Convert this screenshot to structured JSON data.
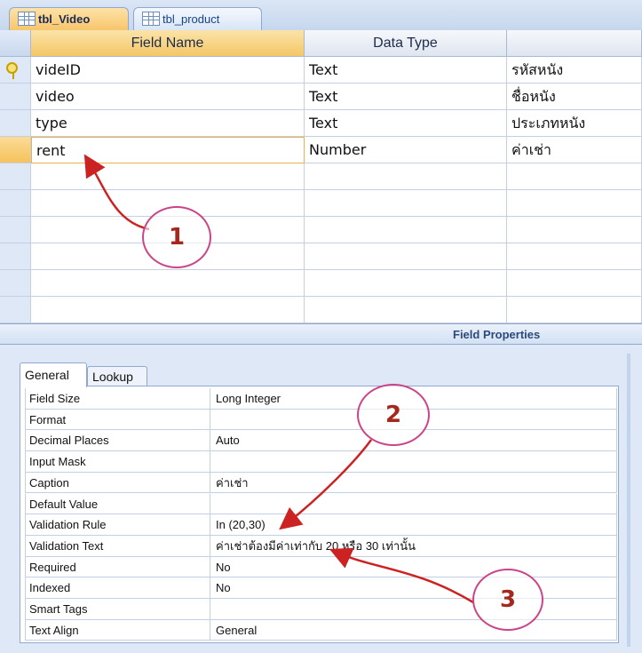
{
  "tabs": [
    {
      "label": "tbl_Video"
    },
    {
      "label": "tbl_product"
    }
  ],
  "grid": {
    "headers": {
      "field_name": "Field Name",
      "data_type": "Data Type",
      "description": ""
    },
    "rows": [
      {
        "field": "videID",
        "type": "Text",
        "description": "รหัสหนัง",
        "primary_key": true
      },
      {
        "field": "video",
        "type": "Text",
        "description": "ชื่อหนัง"
      },
      {
        "field": "type",
        "type": "Text",
        "description": "ประเภทหนัง"
      },
      {
        "field": "rent",
        "type": "Number",
        "description": "ค่าเช่า",
        "selected": true
      }
    ]
  },
  "field_properties_label": "Field Properties",
  "props_tabs": {
    "general": "General",
    "lookup": "Lookup"
  },
  "properties": [
    {
      "name": "Field Size",
      "value": "Long Integer"
    },
    {
      "name": "Format",
      "value": ""
    },
    {
      "name": "Decimal Places",
      "value": "Auto"
    },
    {
      "name": "Input Mask",
      "value": ""
    },
    {
      "name": "Caption",
      "value": "ค่าเช่า"
    },
    {
      "name": "Default Value",
      "value": ""
    },
    {
      "name": "Validation Rule",
      "value": "In (20,30)"
    },
    {
      "name": "Validation Text",
      "value": "ค่าเช่าต้องมีค่าเท่ากับ 20 หรือ 30 เท่านั้น"
    },
    {
      "name": "Required",
      "value": "No"
    },
    {
      "name": "Indexed",
      "value": "No"
    },
    {
      "name": "Smart Tags",
      "value": ""
    },
    {
      "name": "Text Align",
      "value": "General"
    }
  ],
  "annotations": [
    "1",
    "2",
    "3"
  ],
  "colors": {
    "annotation_ring": "#cc4488",
    "annotation_arrow": "#cc2222",
    "selected_tab": "#f8c56b"
  }
}
